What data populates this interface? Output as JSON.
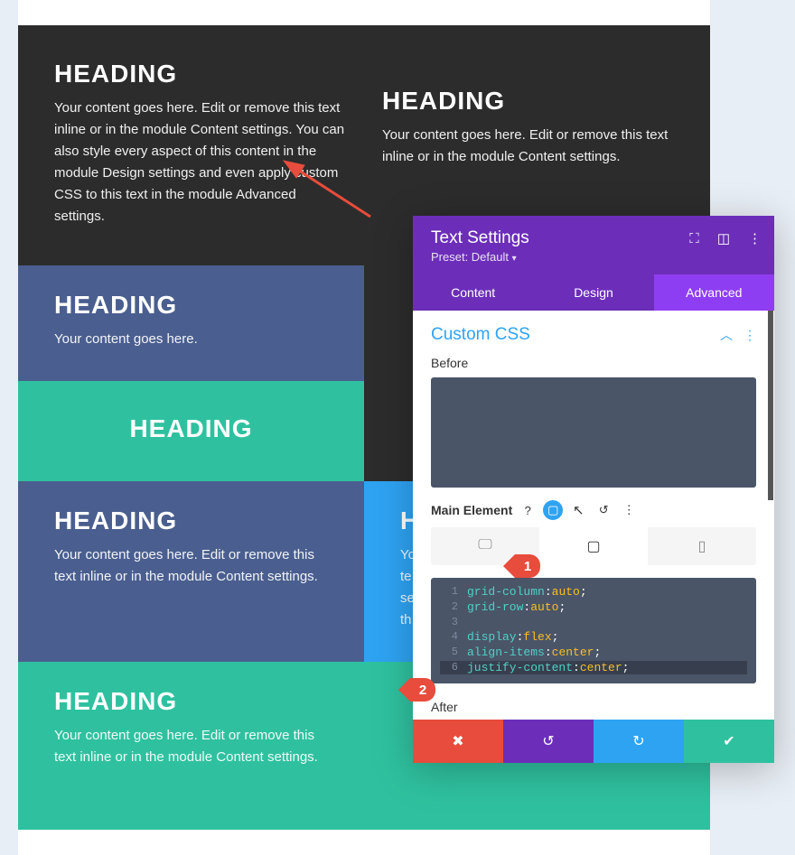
{
  "blocks": {
    "a_head": "HEADING",
    "a_body": "Your content goes here. Edit or remove this text inline or in the module Content settings. You can also style every aspect of this content in the module Design settings and even apply custom CSS to this text in the module Advanced settings.",
    "b_head": "HEADING",
    "b_body": "Your content goes here. Edit or remove this text inline or in the module Content settings.",
    "c_head": "HEADING",
    "c_body": "Your content goes here.",
    "d_head": "HEADING",
    "e_head": "H",
    "e_body": "Yo",
    "f_head": "HEADING",
    "f_body": "Your content goes here. Edit or remove this text inline or in the module Content settings.",
    "g_head": "H",
    "g_body_l1": "Yo",
    "g_body_l2": "te",
    "g_body_l3": "se",
    "g_body_l4": "th",
    "h_head": "HEADING",
    "h_body": "Your content goes here. Edit or remove this text inline or in the module Content settings."
  },
  "panel": {
    "title": "Text Settings",
    "preset": "Preset: Default",
    "tabs": {
      "content": "Content",
      "design": "Design",
      "advanced": "Advanced"
    },
    "custom_css": "Custom CSS",
    "before": "Before",
    "main_element": "Main Element",
    "after": "After",
    "code": {
      "l1": {
        "n": "1",
        "prop": "grid-column",
        "val": "auto"
      },
      "l2": {
        "n": "2",
        "prop": "grid-row",
        "val": "auto"
      },
      "l3": {
        "n": "3"
      },
      "l4": {
        "n": "4",
        "prop": "display",
        "val": "flex"
      },
      "l5": {
        "n": "5",
        "prop": "align-items",
        "val": "center"
      },
      "l6": {
        "n": "6",
        "prop": "justify-content",
        "val": "center"
      }
    }
  },
  "annotations": {
    "one": "1",
    "two": "2"
  }
}
